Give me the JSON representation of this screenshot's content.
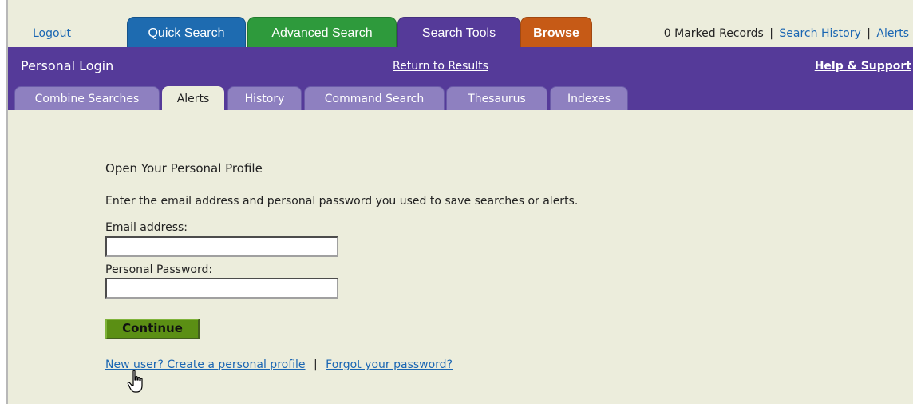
{
  "top": {
    "logout": "Logout",
    "tabs": [
      {
        "label": "Quick Search"
      },
      {
        "label": "Advanced Search"
      },
      {
        "label": "Search Tools"
      },
      {
        "label": "Browse"
      }
    ],
    "marked_records": "0 Marked Records",
    "separator": "|",
    "search_history": "Search History",
    "alerts": "Alerts"
  },
  "header": {
    "title": "Personal Login",
    "return_link": "Return to Results",
    "help_link": "Help & Support"
  },
  "subtabs": [
    {
      "label": "Combine Searches",
      "active": false
    },
    {
      "label": "Alerts",
      "active": true
    },
    {
      "label": "History",
      "active": false
    },
    {
      "label": "Command Search",
      "active": false
    },
    {
      "label": "Thesaurus",
      "active": false
    },
    {
      "label": "Indexes",
      "active": false
    }
  ],
  "form": {
    "heading": "Open Your Personal Profile",
    "description": "Enter the email address and personal password you used to save searches or alerts.",
    "email_label": "Email address:",
    "email_value": "",
    "password_label": "Personal Password:",
    "password_value": "",
    "continue_label": "Continue",
    "new_user_link": "New user? Create a personal profile",
    "separator": "|",
    "forgot_link": "Forgot your password?"
  },
  "colors": {
    "purple": "#553a99",
    "blue_tab": "#1e6bb0",
    "green_tab": "#2e9a3c",
    "orange_tab": "#c65a16",
    "content_bg": "#eceddc",
    "continue_btn": "#5b8f14"
  },
  "icons": {
    "cursor": "hand-pointer-icon"
  }
}
